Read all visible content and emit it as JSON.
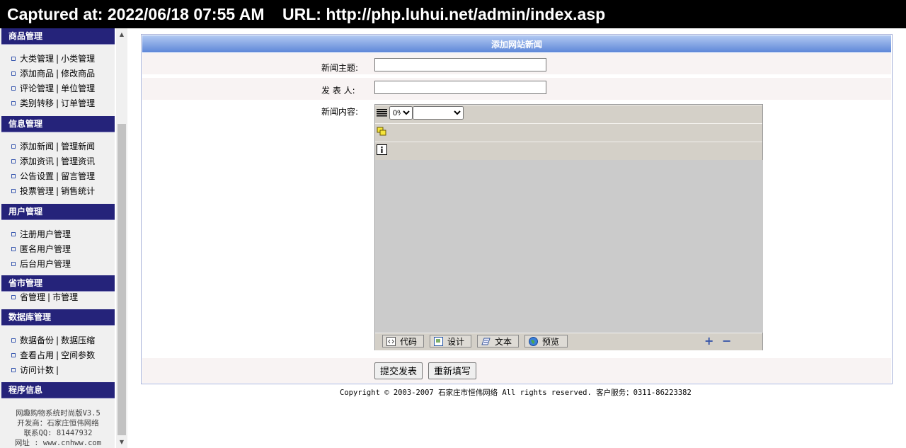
{
  "capture_banner": {
    "text": "Captured at: 2022/06/18 07:55 AM    URL: http://php.luhui.net/admin/index.asp"
  },
  "sidebar": {
    "sections": [
      {
        "title": "商品管理",
        "rows": [
          [
            "大类管理",
            "小类管理"
          ],
          [
            "添加商品",
            "修改商品"
          ],
          [
            "评论管理",
            "单位管理"
          ],
          [
            "类别转移",
            "订单管理"
          ]
        ]
      },
      {
        "title": "信息管理",
        "rows": [
          [
            "添加新闻",
            "管理新闻"
          ],
          [
            "添加资讯",
            "管理资讯"
          ],
          [
            "公告设置",
            "留言管理"
          ],
          [
            "投票管理",
            "销售统计"
          ]
        ]
      },
      {
        "title": "用户管理",
        "rows": [
          [
            "注册用户管理"
          ],
          [
            "匿名用户管理"
          ],
          [
            "后台用户管理"
          ]
        ]
      },
      {
        "title": "省市管理",
        "rows": [
          [
            "省管理",
            "市管理"
          ]
        ]
      },
      {
        "title": "数据库管理",
        "rows": [
          [
            "数据备份",
            "数据压缩"
          ],
          [
            "查看占用",
            "空间参数"
          ],
          [
            "访问计数"
          ]
        ]
      },
      {
        "title": "程序信息",
        "rows": []
      }
    ],
    "separator": "|",
    "program_info": [
      "网趣购物系统时尚版V3.5",
      "开发商：石家庄恒伟网络",
      "联系QQ: 81447932",
      "网址 : www.cnhww.com"
    ]
  },
  "scrollbar": {
    "up_arrow": "▲",
    "down_arrow": "▼"
  },
  "form": {
    "title": "添加网站新闻",
    "subject_label": "新闻主题:",
    "author_label": "发 表 人:",
    "content_label": "新闻内容:",
    "subject_value": "",
    "author_value": "",
    "editor": {
      "font_size_value": "0%",
      "font_value": "",
      "mode_buttons": [
        "代码",
        "设计",
        "文本",
        "预览"
      ],
      "zoom_in": "+",
      "zoom_out": "−"
    },
    "submit_label": "提交发表",
    "reset_label": "重新填写"
  },
  "footer": {
    "text": "Copyright © 2003-2007 石家庄市恒伟网络 All rights reserved. 客户服务：0311-86223382"
  }
}
